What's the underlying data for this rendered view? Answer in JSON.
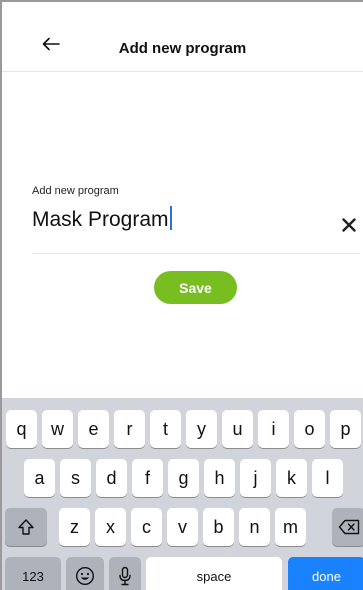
{
  "header": {
    "back_icon": "arrow-left-icon",
    "title": "Add new program"
  },
  "form": {
    "label": "Add new program",
    "value": "Mask Program",
    "clear_icon": "close-icon",
    "save_label": "Save",
    "save_color": "#78be20"
  },
  "keyboard": {
    "row1": [
      "q",
      "w",
      "e",
      "r",
      "t",
      "y",
      "u",
      "i",
      "o",
      "p"
    ],
    "row2": [
      "a",
      "s",
      "d",
      "f",
      "g",
      "h",
      "j",
      "k",
      "l"
    ],
    "row3": [
      "z",
      "x",
      "c",
      "v",
      "b",
      "n",
      "m"
    ],
    "shift_icon": "shift-icon",
    "backspace_icon": "backspace-icon",
    "numbers_label": "123",
    "emoji_icon": "emoji-icon",
    "mic_icon": "microphone-icon",
    "space_label": "space",
    "done_label": "done",
    "done_color": "#1a82ff"
  }
}
